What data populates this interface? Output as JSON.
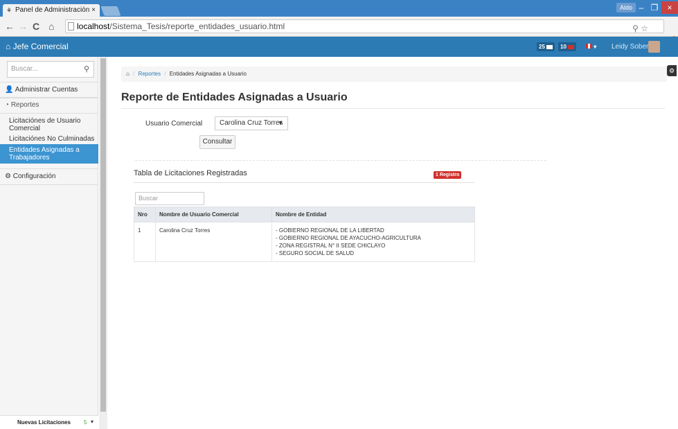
{
  "browser": {
    "tab_title": "Panel de Administración",
    "tab_close": "×",
    "url_host": "localhost",
    "url_path": "/Sistema_Tesis/reporte_entidades_usuario.html",
    "os_user": "Aldo"
  },
  "header": {
    "brand": "Jefe Comercial",
    "badge_messages": "25",
    "badge_tasks": "10",
    "user_name": "Leidy Soberón"
  },
  "sidebar": {
    "search_placeholder": "Buscar...",
    "items": [
      {
        "label": "Administrar Cuentas"
      },
      {
        "label": "Reportes"
      },
      {
        "label": "Configuración"
      }
    ],
    "subitems": [
      {
        "label": "Licitaciónes de Usuario Comercial"
      },
      {
        "label": "Licitaciónes No Culminadas"
      },
      {
        "label": "Entidades Asignadas a Trabajadores"
      }
    ],
    "footer_label": "Nuevas Licitaciones",
    "footer_count": "5"
  },
  "breadcrumb": {
    "reportes": "Reportes",
    "current": "Entidades Asignadas a Usuario"
  },
  "page": {
    "title": "Reporte de Entidades Asignadas a Usuario",
    "user_label": "Usuario Comercial",
    "user_selected": "Carolina Cruz Torres",
    "consultar": "Consultar",
    "table_title": "Tabla de Licitaciones Registradas",
    "badge_count": "1 Registro",
    "table_search_placeholder": "Buscar"
  },
  "table": {
    "headers": [
      "Nro",
      "Nombre de Usuario Comercial",
      "Nombre de Entidad"
    ],
    "rows": [
      {
        "nro": "1",
        "usuario": "Carolina Cruz Torres",
        "entidades": [
          "- GOBIERNO REGIONAL DE LA LIBERTAD",
          "- GOBIERNO REGIONAL DE AYACUCHO-AGRICULTURA",
          "- ZONA REGISTRAL N° II SEDE CHICLAYO",
          "- SEGURO SOCIAL DE SALUD"
        ]
      }
    ]
  },
  "colors": {
    "header_bg": "#2c7bb4",
    "active_item": "#3c94d1",
    "badge_red": "#d0312d"
  }
}
